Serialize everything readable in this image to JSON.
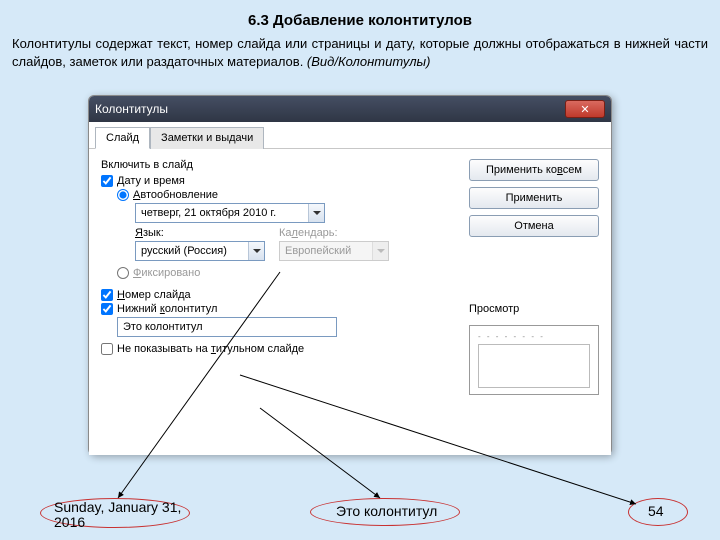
{
  "section": {
    "title": "6.3 Добавление колонтитулов"
  },
  "description": {
    "text": "Колонтитулы содержат текст, номер слайда или страницы и дату, которые должны отображаться в нижней части слайдов, заметок или раздаточных материалов. ",
    "italic": "(Вид/Колонтитулы)"
  },
  "dialog": {
    "title": "Колонтитулы",
    "tabs": {
      "slide": "Слайд",
      "notes": "Заметки и выдачи"
    },
    "left": {
      "include_label": "Включить в слайд",
      "datetime_label": "Дату и время",
      "auto_label": "Автообновление",
      "date_value": "четверг, 21 октября 2010 г.",
      "lang_label": "Язык:",
      "lang_value": "русский (Россия)",
      "cal_label": "Календарь:",
      "cal_value": "Европейский",
      "fixed_label": "Фиксировано",
      "slide_num_label": "Номер слайда",
      "footer_label": "Нижний колонтитул",
      "footer_value": "Это колонтитул",
      "hide_title_label": "Не показывать на титульном слайде"
    },
    "right": {
      "apply_all": "Применить ко всем",
      "apply": "Применить",
      "cancel": "Отмена",
      "preview_label": "Просмотр"
    }
  },
  "footer": {
    "date": "Sunday, January 31, 2016",
    "center": "Это колонтитул",
    "page": "54"
  }
}
